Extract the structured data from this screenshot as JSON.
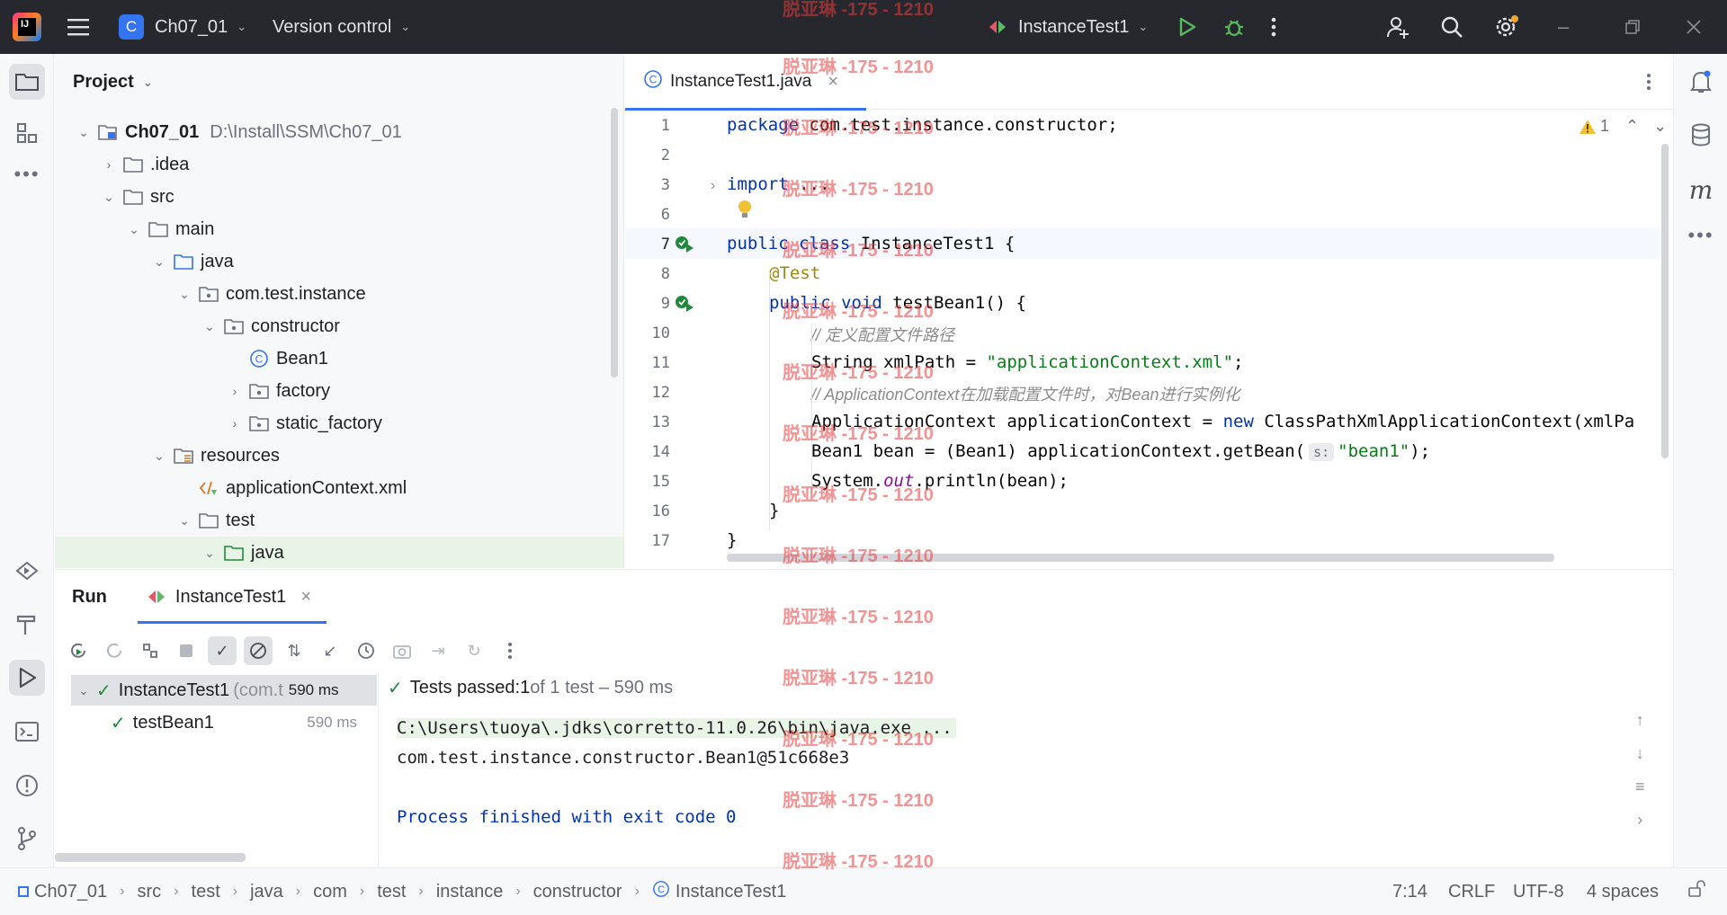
{
  "titlebar": {
    "project_badge": "C",
    "project_name": "Ch07_01",
    "vcs_label": "Version control",
    "run_config": "InstanceTest1"
  },
  "project_panel": {
    "title": "Project",
    "tree": [
      {
        "label": "Ch07_01",
        "hint": "D:\\Install\\SSM\\Ch07_01",
        "icon": "module-icon",
        "expanded": true
      },
      {
        "label": ".idea",
        "icon": "folder-icon",
        "expanded": false
      },
      {
        "label": "src",
        "icon": "folder-icon",
        "expanded": true
      },
      {
        "label": "main",
        "icon": "folder-icon",
        "expanded": true
      },
      {
        "label": "java",
        "icon": "source-folder-icon",
        "expanded": true
      },
      {
        "label": "com.test.instance",
        "icon": "package-icon",
        "expanded": true
      },
      {
        "label": "constructor",
        "icon": "package-icon",
        "expanded": true
      },
      {
        "label": "Bean1",
        "icon": "class-icon"
      },
      {
        "label": "factory",
        "icon": "package-icon",
        "expanded": false
      },
      {
        "label": "static_factory",
        "icon": "package-icon",
        "expanded": false
      },
      {
        "label": "resources",
        "icon": "resources-folder-icon",
        "expanded": true
      },
      {
        "label": "applicationContext.xml",
        "icon": "xml-file-icon"
      },
      {
        "label": "test",
        "icon": "folder-icon",
        "expanded": true
      },
      {
        "label": "java",
        "icon": "test-source-folder-icon",
        "expanded": true
      }
    ]
  },
  "editor": {
    "tab_label": "InstanceTest1.java",
    "warning_count": "1",
    "hint_param": "s:",
    "line_numbers": [
      "1",
      "2",
      "3",
      "6",
      "7",
      "8",
      "9",
      "10",
      "11",
      "12",
      "13",
      "14",
      "15",
      "16",
      "17"
    ],
    "code": {
      "l1_kw": "package",
      "l1_rest": " com.test.instance.constructor;",
      "l3_kw": "import",
      "l3_rest": " ...",
      "l7_kw": "public class",
      "l7_rest": " InstanceTest1 {",
      "l8_ann": "@Test",
      "l9_kw": "public void",
      "l9_rest": " testBean1() {",
      "l10_cmt": "// 定义配置文件路径",
      "l11_a": "String xmlPath = ",
      "l11_str": "\"applicationContext.xml\"",
      "l11_b": ";",
      "l12_cmt": "// ApplicationContext在加载配置文件时，对Bean进行实例化",
      "l13_a": "ApplicationContext applicationContext = ",
      "l13_kw": "new",
      "l13_b": " ClassPathXmlApplicationContext(xmlPa",
      "l14_a": "Bean1 bean = (Bean1) applicationContext.getBean(",
      "l14_str": "\"bean1\"",
      "l14_b": ");",
      "l15_a": "System.",
      "l15_fld": "out",
      "l15_b": ".println(bean);",
      "l16": "}",
      "l17": "}"
    }
  },
  "run_panel": {
    "title": "Run",
    "tab_label": "InstanceTest1",
    "tests": [
      {
        "name": "InstanceTest1",
        "hint": "(com.t",
        "time": "590 ms"
      },
      {
        "name": "testBean1",
        "time": "590 ms"
      }
    ],
    "status_prefix": "Tests passed: ",
    "status_count": "1",
    "status_suffix": " of 1 test – 590 ms",
    "console": [
      "C:\\Users\\tuoya\\.jdks\\corretto-11.0.26\\bin\\java.exe ...",
      "com.test.instance.constructor.Bean1@51c668e3",
      "",
      "Process finished with exit code 0"
    ]
  },
  "statusbar": {
    "breadcrumbs": [
      "Ch07_01",
      "src",
      "test",
      "java",
      "com",
      "test",
      "instance",
      "constructor",
      "InstanceTest1"
    ],
    "position": "7:14",
    "line_separator": "CRLF",
    "encoding": "UTF-8",
    "indent": "4 spaces"
  },
  "watermark": "脱亚琳 -175 - 1210",
  "colors": {
    "accent": "#3574f0",
    "success": "#208a3c",
    "keyword": "#0033b3",
    "string": "#067d17",
    "annotation": "#9e880d",
    "titlebar_bg": "#27282e"
  }
}
